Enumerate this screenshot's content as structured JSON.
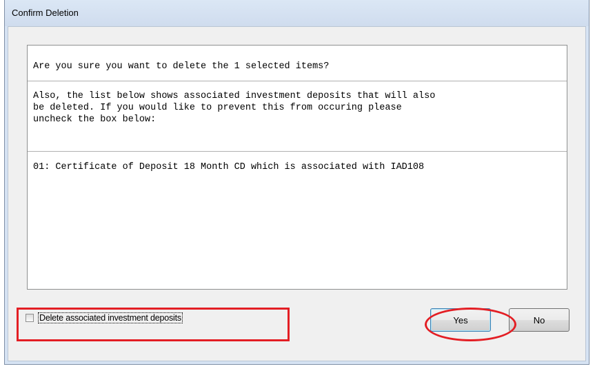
{
  "window": {
    "title": "Confirm Deletion"
  },
  "message": {
    "question": "Are you sure you want to delete the 1 selected items?",
    "explanation": "Also, the list below shows associated investment deposits that will also\nbe deleted. If you would like to prevent this from occuring please\nuncheck the box below:"
  },
  "deposits": {
    "items": [
      "01: Certificate of Deposit 18 Month CD which is associated with IAD108"
    ]
  },
  "options": {
    "delete_associated_label": "Delete associated investment deposits",
    "delete_associated_checked": false
  },
  "buttons": {
    "yes_label": "Yes",
    "no_label": "No"
  },
  "annotations": {
    "highlight_color": "#e31e24"
  }
}
